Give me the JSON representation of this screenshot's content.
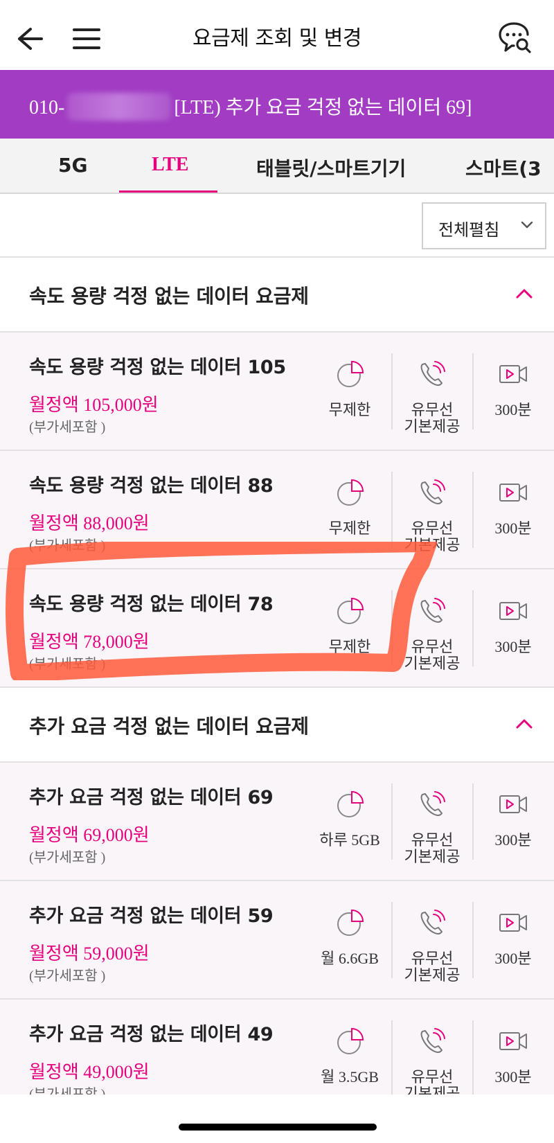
{
  "header": {
    "title": "요금제 조회 및 변경",
    "back_icon": "arrow-left-icon",
    "menu_icon": "hamburger-icon",
    "chat_icon": "chat-search-icon"
  },
  "banner": {
    "number_prefix": "010-",
    "plan_label": "[LTE) 추가 요금 걱정 없는 데이터 69]",
    "background": "#a13cc3"
  },
  "tabs": [
    {
      "label": "5G",
      "active": false
    },
    {
      "label": "LTE",
      "active": true
    },
    {
      "label": "태블릿/스마트기기",
      "active": false
    },
    {
      "label": "스마트(3",
      "active": false
    }
  ],
  "toolbar": {
    "expand_label": "전체펼침"
  },
  "colors": {
    "accent": "#e6007e",
    "banner": "#a13cc3",
    "row_bg": "#faf5f9"
  },
  "sections": [
    {
      "title": "속도 용량 걱정 없는 데이터 요금제",
      "plans": [
        {
          "name": "속도 용량 걱정 없는 데이터 105",
          "price": "월정액 105,000원",
          "tax": "(부가세포함 )",
          "data": "무제한",
          "call_line1": "유무선",
          "call_line2": "기본제공",
          "video": "300분"
        },
        {
          "name": "속도 용량 걱정 없는 데이터 88",
          "price": "월정액 88,000원",
          "tax": "(부가세포함 )",
          "data": "무제한",
          "call_line1": "유무선",
          "call_line2": "기본제공",
          "video": "300분"
        },
        {
          "name": "속도 용량 걱정 없는 데이터 78",
          "price": "월정액 78,000원",
          "tax": "(부가세포함 )",
          "data": "무제한",
          "call_line1": "유무선",
          "call_line2": "기본제공",
          "video": "300분"
        }
      ]
    },
    {
      "title": "추가 요금 걱정 없는 데이터 요금제",
      "plans": [
        {
          "name": "추가 요금 걱정 없는 데이터 69",
          "price": "월정액 69,000원",
          "tax": "(부가세포함 )",
          "data": "하루 5GB",
          "call_line1": "유무선",
          "call_line2": "기본제공",
          "video": "300분"
        },
        {
          "name": "추가 요금 걱정 없는 데이터 59",
          "price": "월정액 59,000원",
          "tax": "(부가세포함 )",
          "data": "월 6.6GB",
          "call_line1": "유무선",
          "call_line2": "기본제공",
          "video": "300분"
        },
        {
          "name": "추가 요금 걱정 없는 데이터 49",
          "price": "월정액 49,000원",
          "tax": "(부가세포함 )",
          "data": "월 3.5GB",
          "call_line1": "유무선",
          "call_line2": "기본제공",
          "video": "300분"
        }
      ]
    }
  ]
}
